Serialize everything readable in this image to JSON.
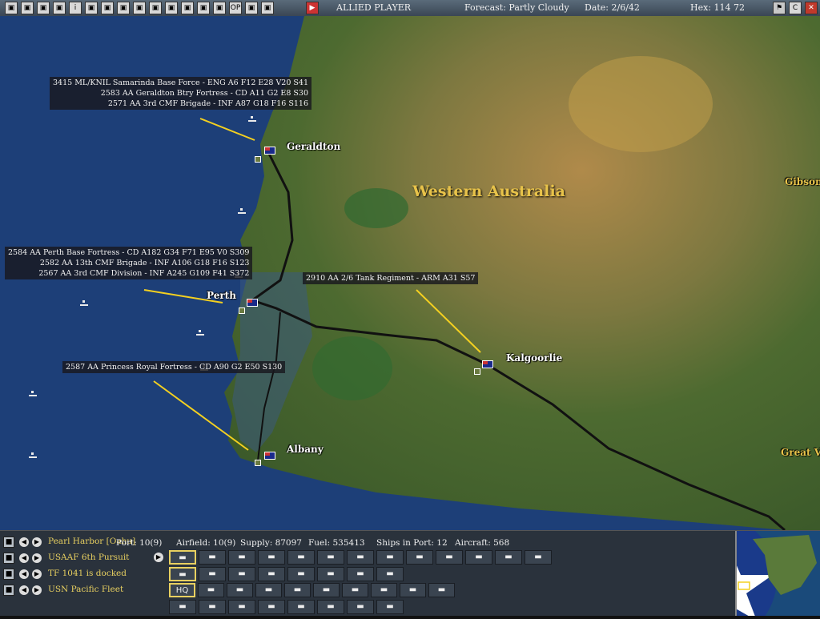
{
  "toolbar": {
    "player": "ALLIED PLAYER",
    "forecast": "Forecast: Partly Cloudy",
    "date": "Date: 2/6/42",
    "hex": "Hex: 114 72",
    "buttons": [
      "page-icon",
      "list-icon",
      "report-icon",
      "report-icon",
      "info-icon",
      "star-icon",
      "aircraft-icon",
      "aircraft-icon",
      "flag-icon",
      "scale-icon",
      "grid-icon",
      "group-icon",
      "globe-icon",
      "globe-icon",
      "ops-icon",
      "map-icon",
      "save-icon"
    ],
    "ops_label": "OP",
    "info_label": "i",
    "end_turn_icon": "play-icon",
    "right_buttons": [
      "flag-icon",
      "copy-icon",
      "close-icon"
    ],
    "copy_label": "C"
  },
  "map": {
    "region_label": "Western Australia",
    "gibson_label": "Gibson",
    "great_label": "Great V",
    "cities": {
      "geraldton": "Geraldton",
      "perth": "Perth",
      "kalgoorlie": "Kalgoorlie",
      "albany": "Albany"
    },
    "unit_groups": {
      "geraldton": [
        "3415 ML/KNIL Samarinda Base Force - ENG  A6  F12  E28  V20  S41",
        "2583 AA Geraldton Btry Fortress - CD  A11  G2  E8  S30",
        "2571 AA 3rd CMF Brigade - INF  A87  G18  F16  S116"
      ],
      "perth": [
        "2584 AA Perth Base Fortress - CD  A182  G34  F71  E95  V0  S309",
        "2582 AA 13th CMF Brigade - INF  A106  G18  F16  S123",
        "2567 AA 3rd CMF Division - INF  A245  G109  F41  S372"
      ],
      "kalgoorlie": [
        "2910 AA 2/6 Tank Regiment - ARM  A31  S57"
      ],
      "albany": [
        "2587 AA Princess Royal Fortress - CD  A90  G2  E50  S130"
      ]
    },
    "colors": {
      "leader": "#f4d020",
      "rail": "#111111",
      "sea": "#1d3f78",
      "label_bg": "#1a1a1e"
    }
  },
  "panel": {
    "rows": [
      {
        "icon": "anchor-icon",
        "label": "Pearl Harbor [Oahu]"
      },
      {
        "icon": "aircraft-icon",
        "label": "USAAF 6th Pursuit"
      },
      {
        "icon": "ship-icon",
        "label": "TF 1041 is docked"
      },
      {
        "icon": "flag-icon",
        "label": "USN Pacific Fleet"
      }
    ],
    "stats": {
      "port": "Port: 10(9)",
      "airfield": "Airfield: 10(9)",
      "supply": "Supply: 87097",
      "fuel": "Fuel: 535413",
      "ships": "Ships in Port: 12",
      "aircraft": "Aircraft: 568"
    },
    "air_slots": [
      "fighter-icon",
      "fighter-icon",
      "fighter-icon",
      "fighter-icon",
      "fighter-icon",
      "fighter-icon",
      "bomber-icon",
      "bomber-icon",
      "bomber-icon",
      "bomber-icon",
      "bomber-icon",
      "bomber-icon",
      "bomber-icon"
    ],
    "ship_slots": [
      "carrier-icon",
      "cruiser-icon",
      "destroyer-icon",
      "battleship-icon",
      "battleship-icon",
      "cruiser-icon",
      "transport-icon",
      "submarine-icon"
    ],
    "cmd_slots": [
      "HQ",
      "",
      "",
      "",
      "",
      "",
      "",
      "",
      "",
      ""
    ],
    "cmd_icons": [
      "hq-icon",
      "supply-icon",
      "unload-icon",
      "cross-icon",
      "cross-icon",
      "building-icon",
      "triangle-icon",
      "triangle-icon",
      "triangle-icon",
      "building-icon"
    ],
    "base_slots": [
      "shipyard-icon",
      "factory-icon",
      "factory-icon",
      "ship-icon",
      "ship-icon",
      "aircraft-icon",
      "ship-icon",
      "ship-icon"
    ],
    "selected_air": 0,
    "selected_ship": 0,
    "selected_cmd": 0
  }
}
